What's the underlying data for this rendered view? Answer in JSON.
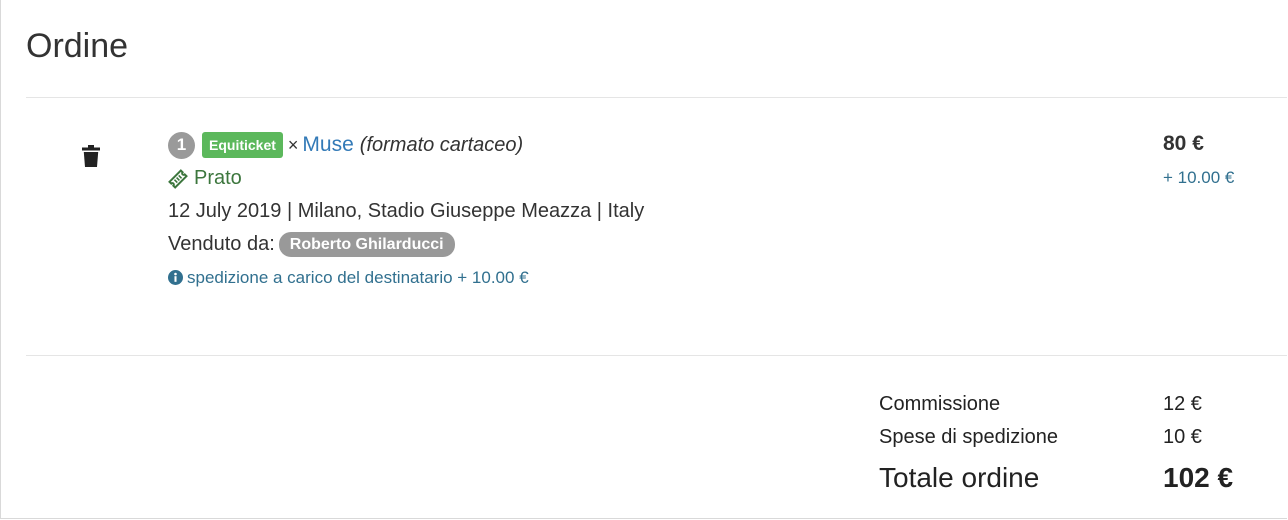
{
  "page": {
    "title": "Ordine"
  },
  "order_item": {
    "quantity": "1",
    "badge": "Equiticket",
    "times": "×",
    "event_name": "Muse",
    "format": "(formato cartaceo)",
    "sector": "Prato",
    "details": "12 July 2019 | Milano, Stadio Giuseppe Meazza | Italy",
    "seller_label": "Venduto da:",
    "seller_name": "Roberto Ghilarducci",
    "shipping_note": "spedizione a carico del destinatario + 10.00 €",
    "price": "80 €",
    "shipping_price": "+ 10.00 €",
    "icons": {
      "delete": "trash-icon",
      "sector": "ticket-icon",
      "note": "info-icon"
    }
  },
  "summary": {
    "rows": [
      {
        "label": "Commissione",
        "value": "12 €"
      },
      {
        "label": "Spese di spedizione",
        "value": "10 €"
      }
    ],
    "total_label": "Totale ordine",
    "total_value": "102 €"
  },
  "colors": {
    "badge_green": "#5cb85c",
    "link_blue": "#337ab7",
    "sector_green": "#3c763d",
    "info_blue": "#31708f",
    "quantity_gray": "#9a9a9a"
  }
}
